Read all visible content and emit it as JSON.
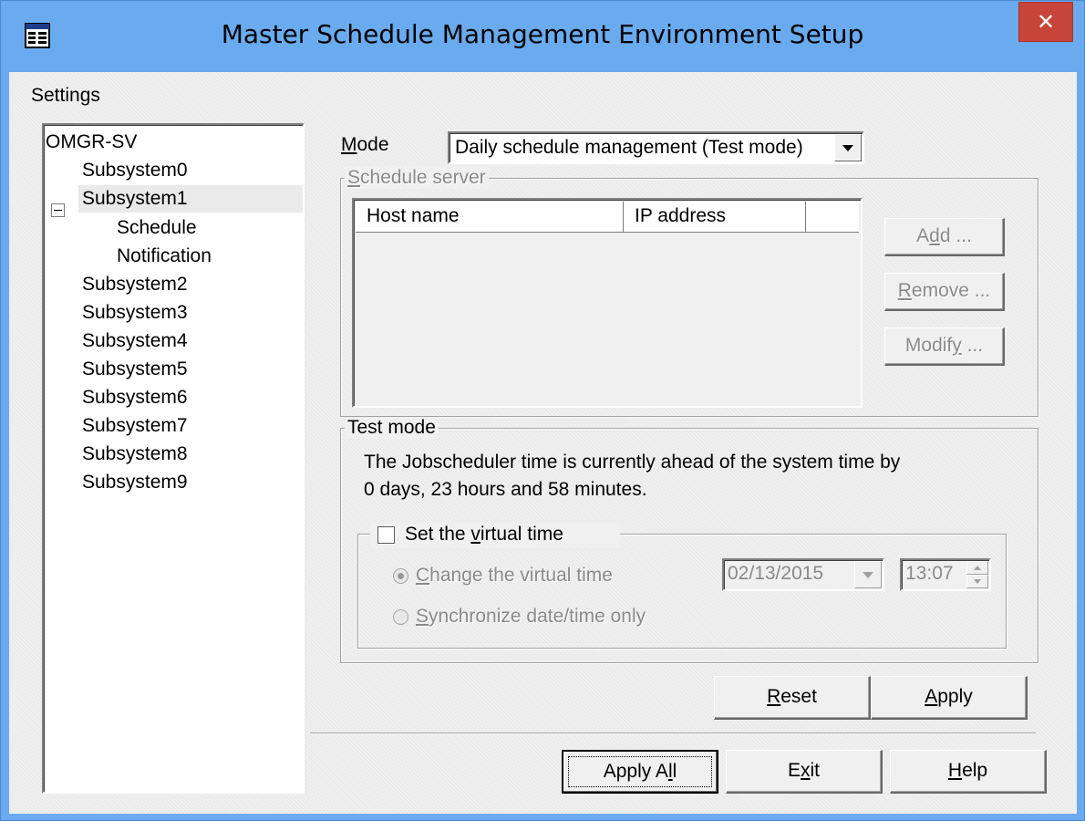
{
  "window": {
    "title": "Master Schedule Management Environment Setup",
    "close_label": "✕",
    "app_icon": "settings-app-icon"
  },
  "settings_label": "Settings",
  "tree": {
    "root": "OMGR-SV",
    "items": [
      {
        "label": "Subsystem0"
      },
      {
        "label": "Subsystem1",
        "expanded": true,
        "selected": true
      },
      {
        "label": "Schedule"
      },
      {
        "label": "Notification"
      },
      {
        "label": "Subsystem2"
      },
      {
        "label": "Subsystem3"
      },
      {
        "label": "Subsystem4"
      },
      {
        "label": "Subsystem5"
      },
      {
        "label": "Subsystem6"
      },
      {
        "label": "Subsystem7"
      },
      {
        "label": "Subsystem8"
      },
      {
        "label": "Subsystem9"
      }
    ]
  },
  "mode": {
    "label_accel": "M",
    "label_rest": "ode",
    "value": "Daily schedule management (Test mode)"
  },
  "schedule_server": {
    "legend_accel": "S",
    "legend_rest": "chedule server",
    "columns": [
      "Host name",
      "IP address"
    ],
    "rows": [],
    "buttons": {
      "add": {
        "pre": "A",
        "accel": "d",
        "post": "d ..."
      },
      "remove": {
        "pre": "",
        "accel": "R",
        "post": "emove ..."
      },
      "modify": {
        "pre": "Modif",
        "accel": "y",
        "post": " ..."
      }
    }
  },
  "test_mode": {
    "legend": "Test mode",
    "message_line1": "The Jobscheduler time is currently ahead of the system time by",
    "message_line2": "0 days, 23 hours and 58 minutes.",
    "virtual_time": {
      "checkbox_pre": "Set the ",
      "checkbox_accel": "v",
      "checkbox_post": "irtual time",
      "checked": false,
      "option_change_accel": "C",
      "option_change_rest": "hange the virtual time",
      "option_sync_accel": "S",
      "option_sync_rest": "ynchronize date/time only",
      "selected_option": "change",
      "date": "02/13/2015",
      "time": "13:07"
    }
  },
  "buttons": {
    "reset": {
      "accel": "R",
      "rest": "eset"
    },
    "apply": {
      "accel": "A",
      "rest": "pply"
    },
    "apply_all": {
      "pre": "Apply A",
      "accel": "l",
      "post": "l"
    },
    "exit": {
      "pre": "E",
      "accel": "x",
      "post": "it"
    },
    "help": {
      "accel": "H",
      "rest": "elp"
    }
  },
  "colors": {
    "titlebar": "#6aabf0",
    "close_button": "#c7443a",
    "dialog_bg": "#f0f0f0"
  }
}
